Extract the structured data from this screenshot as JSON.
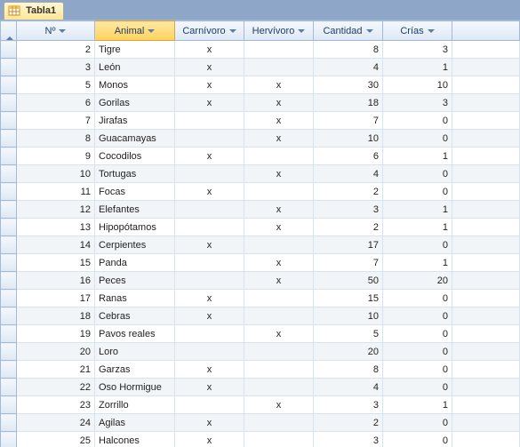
{
  "tab": {
    "label": "Tabla1",
    "icon": "table-icon"
  },
  "columns": {
    "no": "Nº",
    "animal": "Animal",
    "carnivoro": "Carnívoro",
    "hervivoro": "Hervívoro",
    "cantidad": "Cantidad",
    "crias": "Crías"
  },
  "selected_column": "animal",
  "rows": [
    {
      "no": 2,
      "animal": "Tigre",
      "carnivoro": "x",
      "hervivoro": "",
      "cantidad": 8,
      "crias": 3
    },
    {
      "no": 3,
      "animal": "León",
      "carnivoro": "x",
      "hervivoro": "",
      "cantidad": 4,
      "crias": 1
    },
    {
      "no": 5,
      "animal": "Monos",
      "carnivoro": "x",
      "hervivoro": "x",
      "cantidad": 30,
      "crias": 10
    },
    {
      "no": 6,
      "animal": "Gorilas",
      "carnivoro": "x",
      "hervivoro": "x",
      "cantidad": 18,
      "crias": 3
    },
    {
      "no": 7,
      "animal": "Jirafas",
      "carnivoro": "",
      "hervivoro": "x",
      "cantidad": 7,
      "crias": 0
    },
    {
      "no": 8,
      "animal": "Guacamayas",
      "carnivoro": "",
      "hervivoro": "x",
      "cantidad": 10,
      "crias": 0
    },
    {
      "no": 9,
      "animal": "Cocodilos",
      "carnivoro": "x",
      "hervivoro": "",
      "cantidad": 6,
      "crias": 1
    },
    {
      "no": 10,
      "animal": "Tortugas",
      "carnivoro": "",
      "hervivoro": "x",
      "cantidad": 4,
      "crias": 0
    },
    {
      "no": 11,
      "animal": "Focas",
      "carnivoro": "x",
      "hervivoro": "",
      "cantidad": 2,
      "crias": 0
    },
    {
      "no": 12,
      "animal": "Elefantes",
      "carnivoro": "",
      "hervivoro": "x",
      "cantidad": 3,
      "crias": 1
    },
    {
      "no": 13,
      "animal": "Hipopótamos",
      "carnivoro": "",
      "hervivoro": "x",
      "cantidad": 2,
      "crias": 1
    },
    {
      "no": 14,
      "animal": "Cerpientes",
      "carnivoro": "x",
      "hervivoro": "",
      "cantidad": 17,
      "crias": 0
    },
    {
      "no": 15,
      "animal": "Panda",
      "carnivoro": "",
      "hervivoro": "x",
      "cantidad": 7,
      "crias": 1
    },
    {
      "no": 16,
      "animal": "Peces",
      "carnivoro": "",
      "hervivoro": "x",
      "cantidad": 50,
      "crias": 20
    },
    {
      "no": 17,
      "animal": "Ranas",
      "carnivoro": "x",
      "hervivoro": "",
      "cantidad": 15,
      "crias": 0
    },
    {
      "no": 18,
      "animal": "Cebras",
      "carnivoro": "x",
      "hervivoro": "",
      "cantidad": 10,
      "crias": 0
    },
    {
      "no": 19,
      "animal": "Pavos reales",
      "carnivoro": "",
      "hervivoro": "x",
      "cantidad": 5,
      "crias": 0
    },
    {
      "no": 20,
      "animal": "Loro",
      "carnivoro": "",
      "hervivoro": "",
      "cantidad": 20,
      "crias": 0
    },
    {
      "no": 21,
      "animal": "Garzas",
      "carnivoro": "x",
      "hervivoro": "",
      "cantidad": 8,
      "crias": 0
    },
    {
      "no": 22,
      "animal": "Oso Hormigue",
      "carnivoro": "x",
      "hervivoro": "",
      "cantidad": 4,
      "crias": 0
    },
    {
      "no": 23,
      "animal": "Zorrillo",
      "carnivoro": "",
      "hervivoro": "x",
      "cantidad": 3,
      "crias": 1
    },
    {
      "no": 24,
      "animal": "Agilas",
      "carnivoro": "x",
      "hervivoro": "",
      "cantidad": 2,
      "crias": 0
    },
    {
      "no": 25,
      "animal": "Halcones",
      "carnivoro": "x",
      "hervivoro": "",
      "cantidad": 3,
      "crias": 0
    }
  ]
}
